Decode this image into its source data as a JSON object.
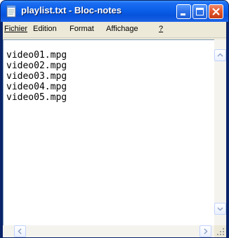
{
  "window": {
    "title": "playlist.txt - Bloc-notes",
    "app_icon": "notepad-icon",
    "controls": [
      "minimize-icon",
      "maximize-icon",
      "close-icon"
    ],
    "colors": {
      "titlebar": "#0a5fe8",
      "close": "#e2552c",
      "chrome": "#ece9d8"
    }
  },
  "menu": {
    "items": [
      {
        "label": "Fichier"
      },
      {
        "label": "Edition"
      },
      {
        "label": "Format"
      },
      {
        "label": "Affichage"
      },
      {
        "label": "?"
      }
    ]
  },
  "editor": {
    "lines": [
      "video01.mpg",
      "video02.mpg",
      "video03.mpg",
      "video04.mpg",
      "video05.mpg"
    ]
  },
  "scrollbars": {
    "vertical_icons": [
      "arrow-up-icon",
      "arrow-down-icon"
    ],
    "horizontal_icons": [
      "arrow-left-icon",
      "arrow-right-icon"
    ]
  }
}
